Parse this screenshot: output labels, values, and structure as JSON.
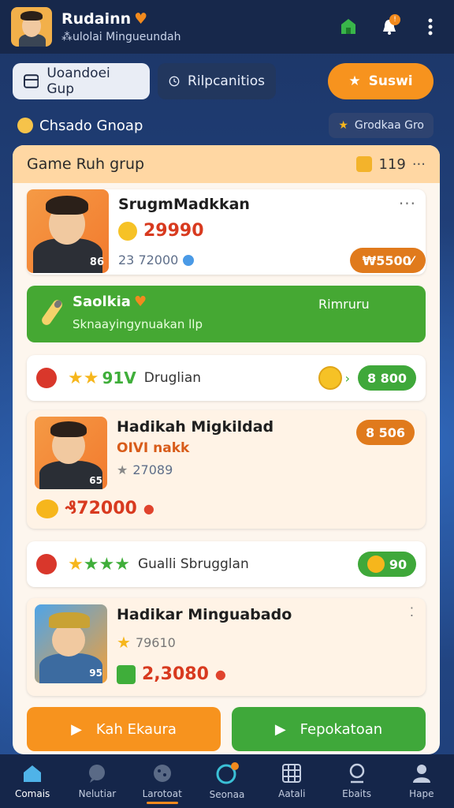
{
  "header": {
    "title": "Rudainn",
    "subtitle": "⁂ulolai Mingueundah"
  },
  "tabs": [
    {
      "label": "Uoandoei Gup"
    },
    {
      "label": "Rilpcanitios"
    },
    {
      "label": "Suswi"
    }
  ],
  "section": {
    "title": "Chsado Gnoap",
    "pill": "Grodkaa Gro"
  },
  "card": {
    "header_title": "Game Ruh  grup",
    "header_count": "119",
    "players": [
      {
        "name": "SrugmMadkkan",
        "score": "29990",
        "meta": "23 72000",
        "pill": "₩5500⁄",
        "badge": "86"
      },
      {
        "name": "Hadikah Migkildad",
        "sub": "OIVI nakk",
        "meta": "27089",
        "score": "₰72000",
        "pill": "8 506",
        "badge": "65"
      },
      {
        "name": "Hadikar Minguabado",
        "meta": "79610",
        "score": "2,3080",
        "badge": "95"
      }
    ],
    "banner": {
      "title": "Saolkia",
      "subtitle": "Sknaayingynuakan  llp",
      "right": "Rimruru"
    },
    "strips": [
      {
        "stars_label": "91V",
        "text": "Druglian",
        "pill": "8 800"
      },
      {
        "text": "Gualli Sbrugglan",
        "pill": "90"
      }
    ],
    "buttons": [
      {
        "label": "Kah Ekaura"
      },
      {
        "label": "Fepokatoan"
      }
    ]
  },
  "nav": [
    {
      "label": "Comais",
      "icon": "home-icon"
    },
    {
      "label": "Nelutiar",
      "icon": "chat-icon"
    },
    {
      "label": "Larotoat",
      "icon": "cookie-icon"
    },
    {
      "label": "Seonaa",
      "icon": "circle-icon"
    },
    {
      "label": "Aatali",
      "icon": "grid-icon"
    },
    {
      "label": "Ebaits",
      "icon": "pin-icon"
    },
    {
      "label": "Hape",
      "icon": "user-icon"
    }
  ]
}
